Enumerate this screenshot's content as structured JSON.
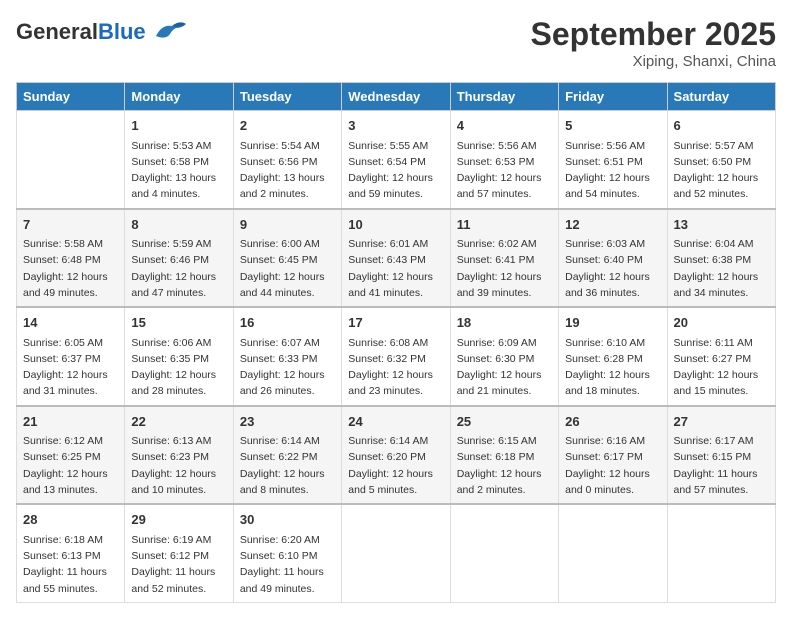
{
  "header": {
    "logo_general": "General",
    "logo_blue": "Blue",
    "month_title": "September 2025",
    "location": "Xiping, Shanxi, China"
  },
  "weekdays": [
    "Sunday",
    "Monday",
    "Tuesday",
    "Wednesday",
    "Thursday",
    "Friday",
    "Saturday"
  ],
  "weeks": [
    [
      {
        "day": "",
        "info": ""
      },
      {
        "day": "1",
        "info": "Sunrise: 5:53 AM\nSunset: 6:58 PM\nDaylight: 13 hours\nand 4 minutes."
      },
      {
        "day": "2",
        "info": "Sunrise: 5:54 AM\nSunset: 6:56 PM\nDaylight: 13 hours\nand 2 minutes."
      },
      {
        "day": "3",
        "info": "Sunrise: 5:55 AM\nSunset: 6:54 PM\nDaylight: 12 hours\nand 59 minutes."
      },
      {
        "day": "4",
        "info": "Sunrise: 5:56 AM\nSunset: 6:53 PM\nDaylight: 12 hours\nand 57 minutes."
      },
      {
        "day": "5",
        "info": "Sunrise: 5:56 AM\nSunset: 6:51 PM\nDaylight: 12 hours\nand 54 minutes."
      },
      {
        "day": "6",
        "info": "Sunrise: 5:57 AM\nSunset: 6:50 PM\nDaylight: 12 hours\nand 52 minutes."
      }
    ],
    [
      {
        "day": "7",
        "info": "Sunrise: 5:58 AM\nSunset: 6:48 PM\nDaylight: 12 hours\nand 49 minutes."
      },
      {
        "day": "8",
        "info": "Sunrise: 5:59 AM\nSunset: 6:46 PM\nDaylight: 12 hours\nand 47 minutes."
      },
      {
        "day": "9",
        "info": "Sunrise: 6:00 AM\nSunset: 6:45 PM\nDaylight: 12 hours\nand 44 minutes."
      },
      {
        "day": "10",
        "info": "Sunrise: 6:01 AM\nSunset: 6:43 PM\nDaylight: 12 hours\nand 41 minutes."
      },
      {
        "day": "11",
        "info": "Sunrise: 6:02 AM\nSunset: 6:41 PM\nDaylight: 12 hours\nand 39 minutes."
      },
      {
        "day": "12",
        "info": "Sunrise: 6:03 AM\nSunset: 6:40 PM\nDaylight: 12 hours\nand 36 minutes."
      },
      {
        "day": "13",
        "info": "Sunrise: 6:04 AM\nSunset: 6:38 PM\nDaylight: 12 hours\nand 34 minutes."
      }
    ],
    [
      {
        "day": "14",
        "info": "Sunrise: 6:05 AM\nSunset: 6:37 PM\nDaylight: 12 hours\nand 31 minutes."
      },
      {
        "day": "15",
        "info": "Sunrise: 6:06 AM\nSunset: 6:35 PM\nDaylight: 12 hours\nand 28 minutes."
      },
      {
        "day": "16",
        "info": "Sunrise: 6:07 AM\nSunset: 6:33 PM\nDaylight: 12 hours\nand 26 minutes."
      },
      {
        "day": "17",
        "info": "Sunrise: 6:08 AM\nSunset: 6:32 PM\nDaylight: 12 hours\nand 23 minutes."
      },
      {
        "day": "18",
        "info": "Sunrise: 6:09 AM\nSunset: 6:30 PM\nDaylight: 12 hours\nand 21 minutes."
      },
      {
        "day": "19",
        "info": "Sunrise: 6:10 AM\nSunset: 6:28 PM\nDaylight: 12 hours\nand 18 minutes."
      },
      {
        "day": "20",
        "info": "Sunrise: 6:11 AM\nSunset: 6:27 PM\nDaylight: 12 hours\nand 15 minutes."
      }
    ],
    [
      {
        "day": "21",
        "info": "Sunrise: 6:12 AM\nSunset: 6:25 PM\nDaylight: 12 hours\nand 13 minutes."
      },
      {
        "day": "22",
        "info": "Sunrise: 6:13 AM\nSunset: 6:23 PM\nDaylight: 12 hours\nand 10 minutes."
      },
      {
        "day": "23",
        "info": "Sunrise: 6:14 AM\nSunset: 6:22 PM\nDaylight: 12 hours\nand 8 minutes."
      },
      {
        "day": "24",
        "info": "Sunrise: 6:14 AM\nSunset: 6:20 PM\nDaylight: 12 hours\nand 5 minutes."
      },
      {
        "day": "25",
        "info": "Sunrise: 6:15 AM\nSunset: 6:18 PM\nDaylight: 12 hours\nand 2 minutes."
      },
      {
        "day": "26",
        "info": "Sunrise: 6:16 AM\nSunset: 6:17 PM\nDaylight: 12 hours\nand 0 minutes."
      },
      {
        "day": "27",
        "info": "Sunrise: 6:17 AM\nSunset: 6:15 PM\nDaylight: 11 hours\nand 57 minutes."
      }
    ],
    [
      {
        "day": "28",
        "info": "Sunrise: 6:18 AM\nSunset: 6:13 PM\nDaylight: 11 hours\nand 55 minutes."
      },
      {
        "day": "29",
        "info": "Sunrise: 6:19 AM\nSunset: 6:12 PM\nDaylight: 11 hours\nand 52 minutes."
      },
      {
        "day": "30",
        "info": "Sunrise: 6:20 AM\nSunset: 6:10 PM\nDaylight: 11 hours\nand 49 minutes."
      },
      {
        "day": "",
        "info": ""
      },
      {
        "day": "",
        "info": ""
      },
      {
        "day": "",
        "info": ""
      },
      {
        "day": "",
        "info": ""
      }
    ]
  ]
}
